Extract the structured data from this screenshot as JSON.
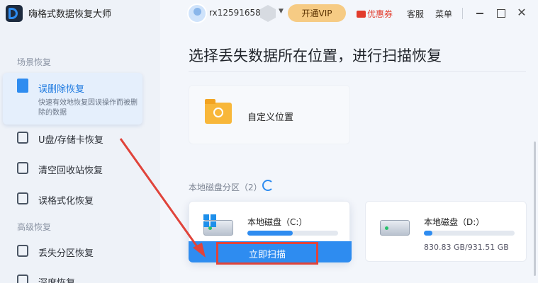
{
  "app": {
    "title": "嗨格式数据恢复大师",
    "logo_icon": "d-logo-icon"
  },
  "header": {
    "username": "rx12591658",
    "vip_button": "开通VIP",
    "coupon": "优惠券",
    "service": "客服",
    "menu": "菜单",
    "window_controls": [
      "minimize-icon",
      "maximize-icon",
      "close-icon"
    ],
    "close_glyph": "✕",
    "caret_glyph": "▼"
  },
  "sidebar": {
    "section1_label": "场景恢复",
    "active_item": {
      "label": "误删除恢复",
      "description": "快速有效地恢复因误操作而被删除的数据"
    },
    "items": [
      {
        "label": "U盘/存储卡恢复",
        "icon": "usb-icon"
      },
      {
        "label": "清空回收站恢复",
        "icon": "trash-icon"
      },
      {
        "label": "误格式化恢复",
        "icon": "format-icon"
      }
    ],
    "section2_label": "高级恢复",
    "advanced_items": [
      {
        "label": "丢失分区恢复",
        "icon": "partition-icon"
      },
      {
        "label": "深度恢复",
        "icon": "deep-scan-icon"
      }
    ]
  },
  "main": {
    "page_title": "选择丢失数据所在位置，进行扫描恢复",
    "custom_location_label": "自定义位置",
    "disk_section_label": "本地磁盘分区（2）",
    "disks": [
      {
        "name": "本地磁盘（C:）",
        "used_fraction": 0.5,
        "size_text": "",
        "scan_button": "立即扫描"
      },
      {
        "name": "本地磁盘（D:）",
        "used_fraction": 0.09,
        "size_text": "830.83 GB/931.51 GB"
      }
    ]
  },
  "colors": {
    "accent": "#2e8cf0",
    "vip": "#f6cb84",
    "coupon": "#e23c2c",
    "annotation": "#e0433a"
  }
}
